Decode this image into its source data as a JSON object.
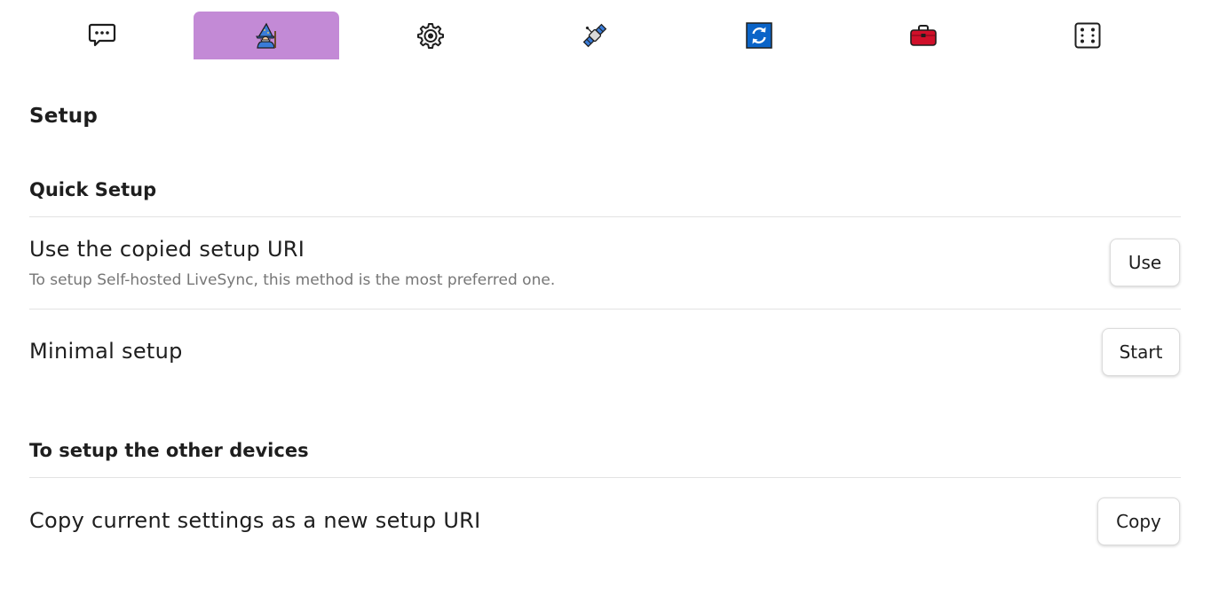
{
  "tabs": [
    {
      "icon": "speech-bubble-icon",
      "active": false
    },
    {
      "icon": "wizard-icon",
      "active": true
    },
    {
      "icon": "gear-icon",
      "active": false
    },
    {
      "icon": "satellite-icon",
      "active": false
    },
    {
      "icon": "sync-icon",
      "active": false
    },
    {
      "icon": "toolbox-icon",
      "active": false
    },
    {
      "icon": "dice-icon",
      "active": false
    }
  ],
  "colors": {
    "active_tab": "#c38ad6",
    "sync_icon_bg": "#0a64c8",
    "toolbox_red": "#d0102a"
  },
  "page": {
    "title": "Setup"
  },
  "quick_setup": {
    "heading": "Quick Setup",
    "use_uri": {
      "name": "Use the copied setup URI",
      "description": "To setup Self-hosted LiveSync, this method is the most preferred one.",
      "button_label": "Use"
    },
    "minimal": {
      "name": "Minimal setup",
      "button_label": "Start"
    }
  },
  "other_devices": {
    "heading": "To setup the other devices",
    "copy_uri": {
      "name": "Copy current settings as a new setup URI",
      "button_label": "Copy"
    }
  }
}
